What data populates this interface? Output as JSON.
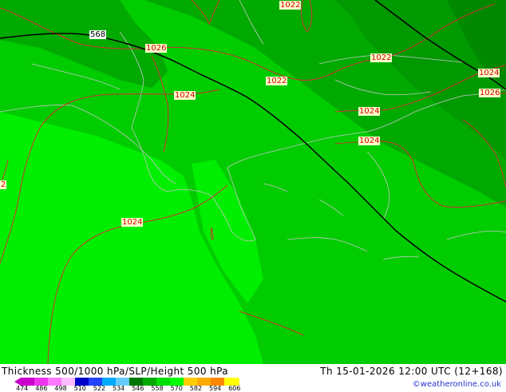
{
  "map": {
    "background_colors": {
      "light_green": "#00ee00",
      "mid_green": "#00cc00",
      "dark_green": "#009900",
      "darker_green": "#008800",
      "contour_red": "#cc3333",
      "height_line": "#000000",
      "coast_line": "#cccccc"
    },
    "isobar_labels": [
      {
        "id": "isobar-label-1022-top",
        "text": "1022"
      },
      {
        "id": "isobar-label-1026-north",
        "text": "1026"
      },
      {
        "id": "isobar-label-1022-northeast",
        "text": "1022"
      },
      {
        "id": "isobar-label-1022-center",
        "text": "1022"
      },
      {
        "id": "isobar-label-1024-east-edge",
        "text": "1024"
      },
      {
        "id": "isobar-label-1026-east-edge",
        "text": "1026"
      },
      {
        "id": "isobar-label-1024-adriatic",
        "text": "1024"
      },
      {
        "id": "isobar-label-1024-aegean-north",
        "text": "1024"
      },
      {
        "id": "isobar-label-1024-aegean",
        "text": "1024"
      },
      {
        "id": "isobar-label-1024-southwest",
        "text": "1024"
      },
      {
        "id": "isobar-label-partial-west",
        "text": "2"
      }
    ],
    "height_labels": [
      {
        "id": "height-label-568",
        "text": "568"
      }
    ]
  },
  "footer": {
    "title_left": "Thickness 500/1000 hPa/SLP/Height 500 hPa",
    "title_right": "Th 15-01-2026 12:00 UTC (12+168)",
    "credit": "©weatheronline.co.uk",
    "legend": {
      "colors": [
        "#cc00cc",
        "#ee33ee",
        "#ff77ff",
        "#ffbbff",
        "#0000cc",
        "#2244ff",
        "#00aaff",
        "#66ccff",
        "#007700",
        "#00aa00",
        "#00dd00",
        "#00ff00",
        "#ffcc00",
        "#ffaa00",
        "#ff8800",
        "#ffff00"
      ],
      "ticks": [
        "474",
        "486",
        "498",
        "510",
        "522",
        "534",
        "546",
        "558",
        "570",
        "582",
        "594",
        "606"
      ]
    }
  }
}
